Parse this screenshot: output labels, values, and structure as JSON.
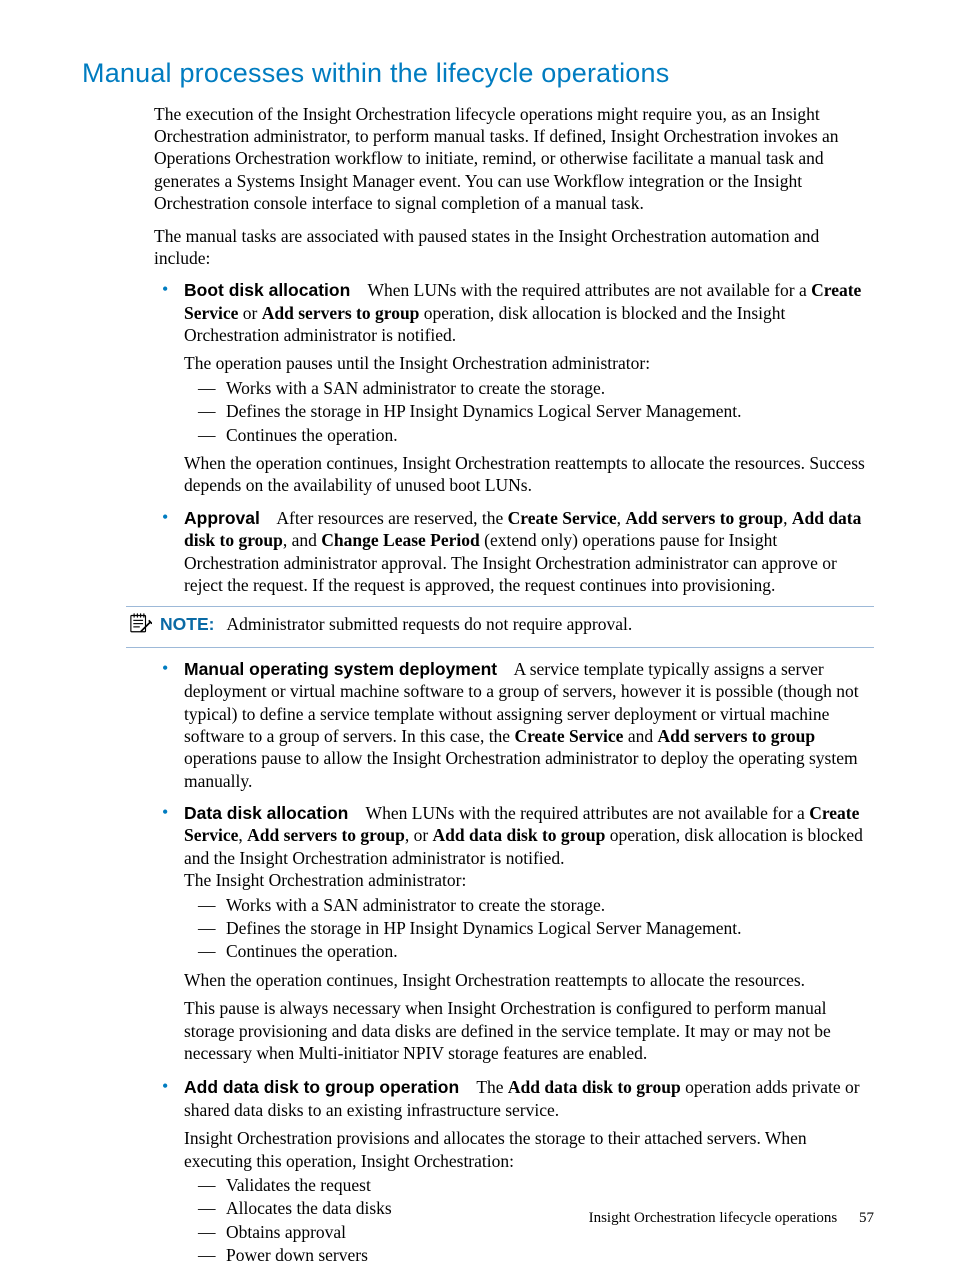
{
  "heading": "Manual processes within the lifecycle operations",
  "intro_p1": "The execution of the Insight Orchestration lifecycle operations might require you, as an Insight Orchestration administrator, to perform manual tasks. If defined, Insight Orchestration invokes an Operations Orchestration workflow to initiate, remind, or otherwise facilitate a manual task and generates a Systems Insight Manager event. You can use Workflow integration or the Insight Orchestration console interface to signal completion of a manual task.",
  "intro_p2": "The manual tasks are associated with paused states in the Insight Orchestration automation and include:",
  "boot": {
    "title": "Boot disk allocation",
    "lead_a": "When LUNs with the required attributes are not available for a ",
    "bold1": "Create Service",
    "mid": " or ",
    "bold2": "Add servers to group",
    "tail": " operation, disk allocation is blocked and the Insight Orchestration administrator is notified.",
    "p2": "The operation pauses until the Insight Orchestration administrator:",
    "d1": "Works with a SAN administrator to create the storage.",
    "d2": "Defines the storage in HP Insight Dynamics Logical Server Management.",
    "d3": "Continues the operation.",
    "p3": "When the operation continues, Insight Orchestration reattempts to allocate the resources. Success depends on the availability of unused boot LUNs."
  },
  "approval": {
    "title": "Approval",
    "lead": "After resources are reserved, the ",
    "b1": "Create Service",
    "s1": ", ",
    "b2": "Add servers to group",
    "s2": ", ",
    "b3": "Add data disk to group",
    "s3": ", and ",
    "b4": "Change Lease Period",
    "tail": " (extend only) operations pause for Insight Orchestration administrator approval. The Insight Orchestration administrator can approve or reject the request. If the request is approved, the request continues into provisioning."
  },
  "note": {
    "label": "NOTE:",
    "text": "Administrator submitted requests do not require approval."
  },
  "manual_os": {
    "title": "Manual operating system deployment",
    "lead": "A service template typically assigns a server deployment or virtual machine software to a group of servers, however it is possible (though not typical) to define a service template without assigning server deployment or virtual machine software to a group of servers. In this case, the ",
    "b1": "Create Service",
    "mid": " and ",
    "b2": "Add servers to group",
    "tail": " operations pause to allow the Insight Orchestration administrator to deploy the operating system manually."
  },
  "data_disk": {
    "title": "Data disk allocation",
    "lead": "When LUNs with the required attributes are not available for a ",
    "b1": "Create Service",
    "s1": ", ",
    "b2": "Add servers to group",
    "s2": ", or ",
    "b3": "Add data disk to group",
    "tail": " operation, disk allocation is blocked and the Insight Orchestration administrator is notified.",
    "p2": "The Insight Orchestration administrator:",
    "d1": "Works with a SAN administrator to create the storage.",
    "d2": "Defines the storage in HP Insight Dynamics Logical Server Management.",
    "d3": "Continues the operation.",
    "p3": "When the operation continues, Insight Orchestration reattempts to allocate the resources.",
    "p4": "This pause is always necessary when Insight Orchestration is configured to perform manual storage provisioning and data disks are defined in the service template. It may or may not be necessary when Multi-initiator NPIV storage features are enabled."
  },
  "add_op": {
    "title": "Add data disk to group operation",
    "lead": "The ",
    "b1": "Add data disk to group",
    "tail": " operation adds private or shared data disks to an existing infrastructure service.",
    "p2": "Insight Orchestration provisions and allocates the storage to their attached servers. When executing this operation, Insight Orchestration:",
    "d1": "Validates the request",
    "d2": "Allocates the data disks",
    "d3": "Obtains approval",
    "d4": "Power down servers"
  },
  "footer": {
    "text": "Insight Orchestration lifecycle operations",
    "page": "57"
  }
}
